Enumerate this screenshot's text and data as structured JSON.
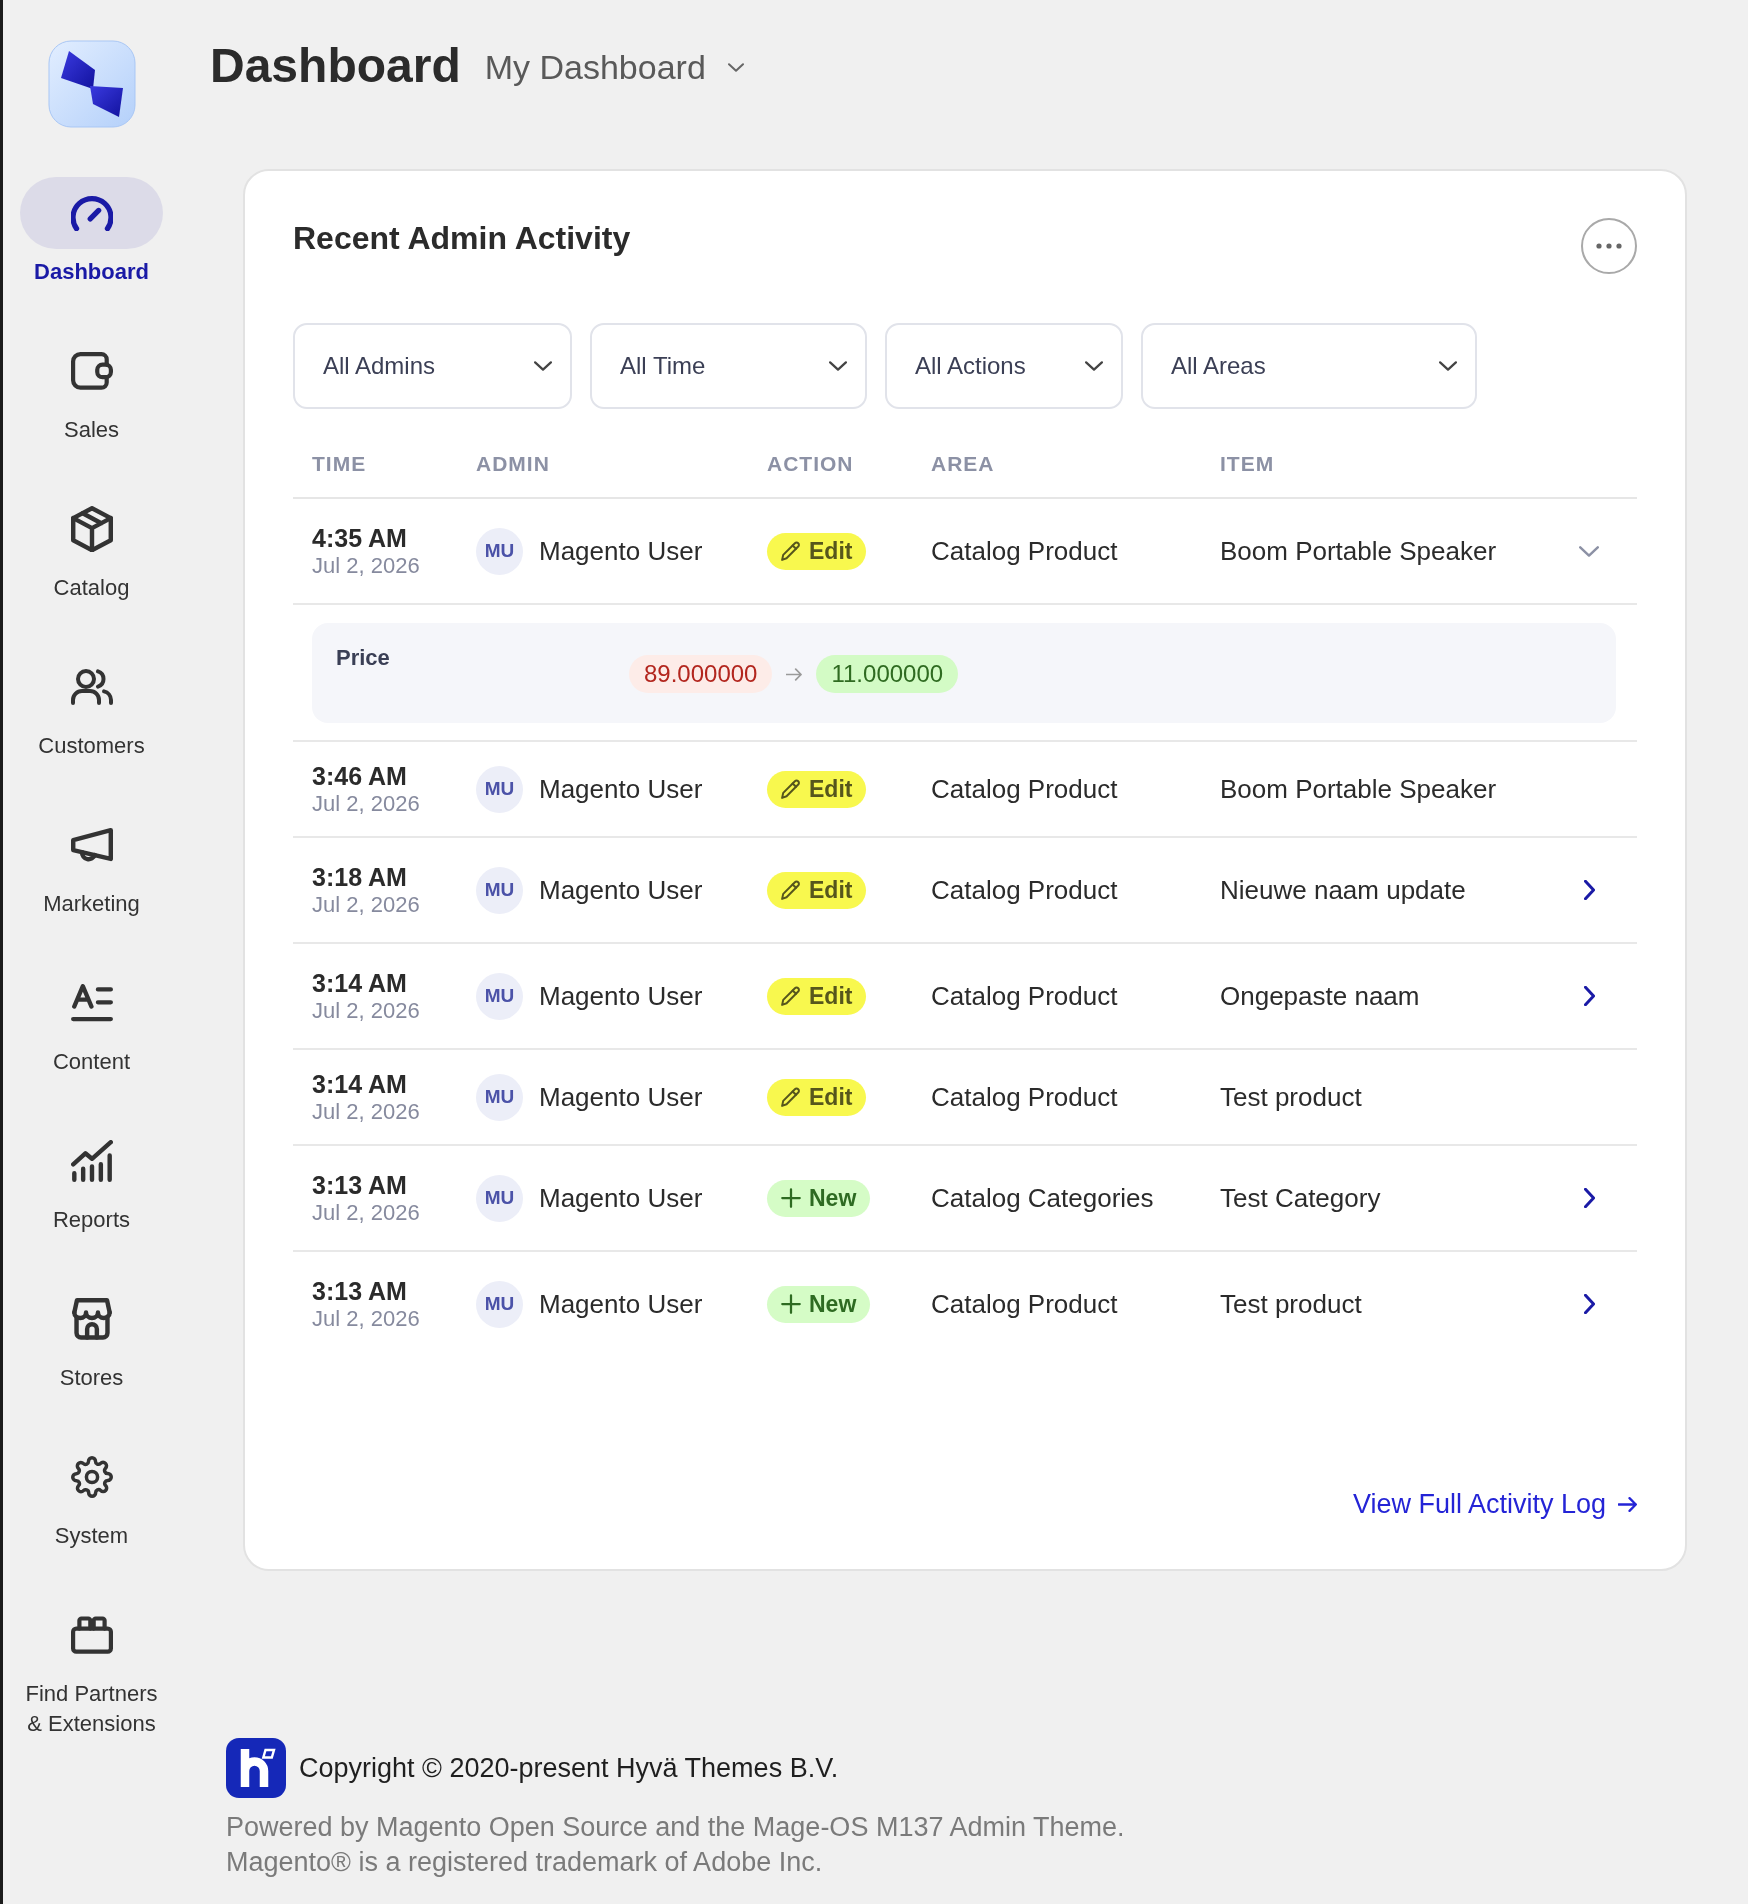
{
  "sidebar": {
    "items": [
      {
        "label": "Dashboard",
        "selected": true
      },
      {
        "label": "Sales",
        "selected": false
      },
      {
        "label": "Catalog",
        "selected": false
      },
      {
        "label": "Customers",
        "selected": false
      },
      {
        "label": "Marketing",
        "selected": false
      },
      {
        "label": "Content",
        "selected": false
      },
      {
        "label": "Reports",
        "selected": false
      },
      {
        "label": "Stores",
        "selected": false
      },
      {
        "label": "System",
        "selected": false
      },
      {
        "label": "Find Partners & Extensions",
        "selected": false
      }
    ]
  },
  "header": {
    "title": "Dashboard",
    "dashboard_switcher": "My Dashboard"
  },
  "activity_card": {
    "title": "Recent Admin Activity",
    "filters": [
      {
        "value": "All Admins"
      },
      {
        "value": "All Time"
      },
      {
        "value": "All Actions"
      },
      {
        "value": "All Areas"
      }
    ],
    "table": {
      "columns": [
        "TIME",
        "ADMIN",
        "ACTION",
        "AREA",
        "ITEM"
      ],
      "rows": [
        {
          "time": "4:35 AM",
          "date": "Jul 2, 2026",
          "admin_initials": "MU",
          "admin": "Magento User",
          "action": {
            "kind": "edit",
            "label": "Edit"
          },
          "area": "Catalog Product",
          "item": "Boom Portable Speaker",
          "expandable": true,
          "expanded": true,
          "changes": [
            {
              "field": "Price",
              "old_value": "89.000000",
              "new_value": "11.000000"
            }
          ]
        },
        {
          "time": "3:46 AM",
          "date": "Jul 2, 2026",
          "admin_initials": "MU",
          "admin": "Magento User",
          "action": {
            "kind": "edit",
            "label": "Edit"
          },
          "area": "Catalog Product",
          "item": "Boom Portable Speaker",
          "expandable": false
        },
        {
          "time": "3:18 AM",
          "date": "Jul 2, 2026",
          "admin_initials": "MU",
          "admin": "Magento User",
          "action": {
            "kind": "edit",
            "label": "Edit"
          },
          "area": "Catalog Product",
          "item": "Nieuwe naam update",
          "expandable": true,
          "expanded": false
        },
        {
          "time": "3:14 AM",
          "date": "Jul 2, 2026",
          "admin_initials": "MU",
          "admin": "Magento User",
          "action": {
            "kind": "edit",
            "label": "Edit"
          },
          "area": "Catalog Product",
          "item": "Ongepaste naam",
          "expandable": true,
          "expanded": false
        },
        {
          "time": "3:14 AM",
          "date": "Jul 2, 2026",
          "admin_initials": "MU",
          "admin": "Magento User",
          "action": {
            "kind": "edit",
            "label": "Edit"
          },
          "area": "Catalog Product",
          "item": "Test product",
          "expandable": false
        },
        {
          "time": "3:13 AM",
          "date": "Jul 2, 2026",
          "admin_initials": "MU",
          "admin": "Magento User",
          "action": {
            "kind": "new",
            "label": "New"
          },
          "area": "Catalog Categories",
          "item": "Test Category",
          "expandable": true,
          "expanded": false
        },
        {
          "time": "3:13 AM",
          "date": "Jul 2, 2026",
          "admin_initials": "MU",
          "admin": "Magento User",
          "action": {
            "kind": "new",
            "label": "New"
          },
          "area": "Catalog Product",
          "item": "Test product",
          "expandable": true,
          "expanded": false
        }
      ]
    },
    "view_all_link": "View Full Activity Log"
  },
  "footer": {
    "copyright": "Copyright © 2020-present Hyvä Themes B.V.",
    "powered_by": "Powered by Magento Open Source and the Mage-OS M137 Admin Theme.",
    "trademark": "Magento® is a registered trademark of Adobe Inc."
  }
}
